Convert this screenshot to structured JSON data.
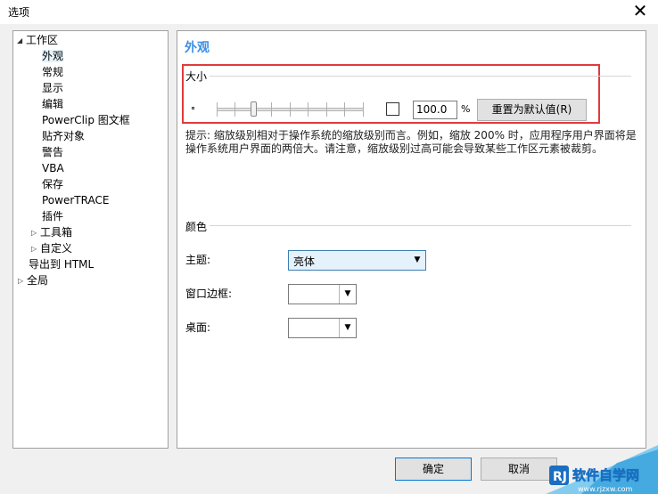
{
  "window": {
    "title": "选项",
    "close_glyph": "✕"
  },
  "tree": {
    "items": [
      {
        "label": "工作区",
        "arrow": "◢"
      },
      {
        "label": "外观",
        "arrow": ""
      },
      {
        "label": "常规",
        "arrow": ""
      },
      {
        "label": "显示",
        "arrow": ""
      },
      {
        "label": "编辑",
        "arrow": ""
      },
      {
        "label": "PowerClip 图文框",
        "arrow": ""
      },
      {
        "label": "贴齐对象",
        "arrow": ""
      },
      {
        "label": "警告",
        "arrow": ""
      },
      {
        "label": "VBA",
        "arrow": ""
      },
      {
        "label": "保存",
        "arrow": ""
      },
      {
        "label": "PowerTRACE",
        "arrow": ""
      },
      {
        "label": "插件",
        "arrow": ""
      },
      {
        "label": "工具箱",
        "arrow": "▷"
      },
      {
        "label": "自定义",
        "arrow": "▷"
      },
      {
        "label": "导出到 HTML",
        "arrow": ""
      },
      {
        "label": "全局",
        "arrow": "▷"
      }
    ],
    "selected": "外观"
  },
  "panel": {
    "title": "外观",
    "size_group": {
      "label": "大小",
      "zoom_value": "100.0",
      "unit": "%",
      "reset_label": "重置为默认值(R)",
      "checkbox_checked": false
    },
    "hint": "提示: 缩放级别相对于操作系统的缩放级别而言。例如，缩放 200% 时，应用程序用户界面将是操作系统用户界面的两倍大。请注意，缩放级别过高可能会导致某些工作区元素被裁剪。",
    "color_group": {
      "label": "颜色",
      "theme_label": "主题:",
      "theme_value": "亮体",
      "border_label": "窗口边框:",
      "border_value": "",
      "desktop_label": "桌面:",
      "desktop_value": ""
    }
  },
  "buttons": {
    "ok": "确定",
    "cancel": "取消"
  },
  "watermark": {
    "text": "软件自学网",
    "url": "www.rjzxw.com"
  },
  "colors": {
    "accent": "#3a8ee6",
    "highlight": "#e03b3b",
    "selection": "#e5f3fb"
  }
}
